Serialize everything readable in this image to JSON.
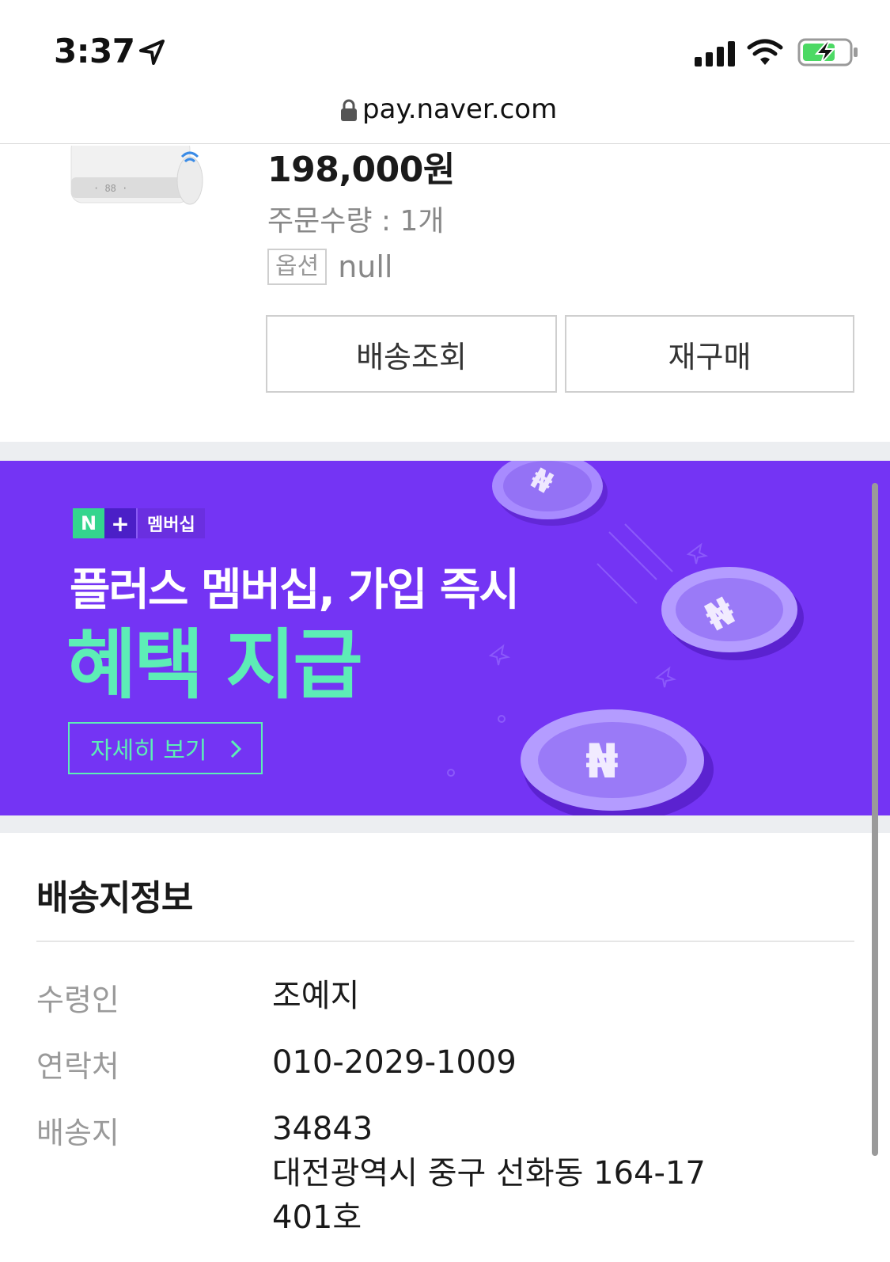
{
  "status_bar": {
    "time": "3:37",
    "icons": [
      "location-arrow-icon",
      "cellular-signal-icon",
      "wifi-icon",
      "battery-charging-icon"
    ]
  },
  "browser": {
    "url": "pay.naver.com"
  },
  "order_item": {
    "price": "198,000원",
    "quantity": "주문수량 : 1개",
    "option_tag": "옵션",
    "option_value": "null",
    "buttons": {
      "delivery_tracking": "배송조회",
      "repurchase": "재구매"
    }
  },
  "banner": {
    "badge_n": "N",
    "badge_plus": "+",
    "badge_label": "멤버십",
    "headline": "플러스 멤버십, 가입 즉시",
    "highlight": "혜택 지급",
    "cta": "자세히 보기",
    "colors": {
      "background": "#7434f4",
      "accent": "#5dedb6"
    }
  },
  "shipping": {
    "title": "배송지정보",
    "rows": [
      {
        "label": "수령인",
        "value": "조예지"
      },
      {
        "label": "연락처",
        "value": "010-2029-1009"
      },
      {
        "label": "배송지",
        "lines": [
          "34843",
          "대전광역시 중구 선화동 164-17",
          "401호"
        ]
      }
    ]
  }
}
